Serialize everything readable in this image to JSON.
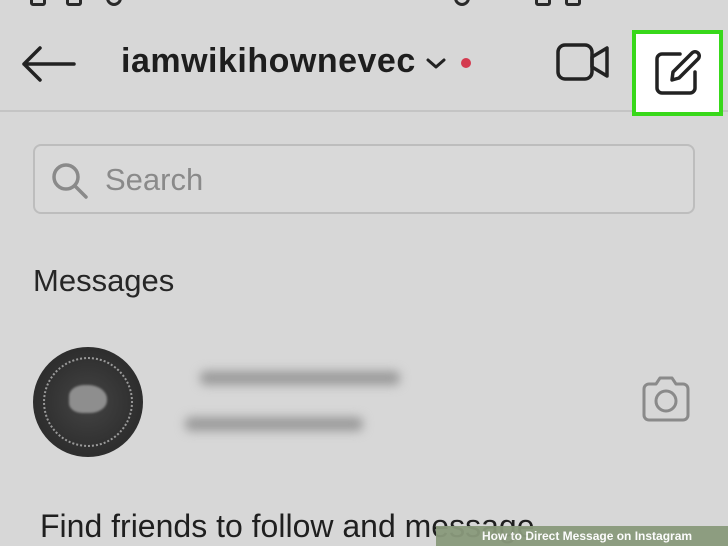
{
  "header": {
    "username": "iamwikihownevec",
    "back_icon": "arrow-left-icon",
    "dropdown_icon": "chevron-down-icon",
    "video_icon": "video-camera-icon",
    "compose_icon": "new-message-compose-icon",
    "unread_dot_color": "#d43a4f",
    "highlight_color": "#38d81a"
  },
  "search": {
    "placeholder": "Search",
    "icon": "search-icon"
  },
  "messages": {
    "heading": "Messages",
    "conversation_camera_icon": "camera-icon"
  },
  "footer": {
    "find_friends_text": "Find friends to follow and message"
  },
  "watermark": {
    "text": "How to Direct Message on Instagram"
  }
}
